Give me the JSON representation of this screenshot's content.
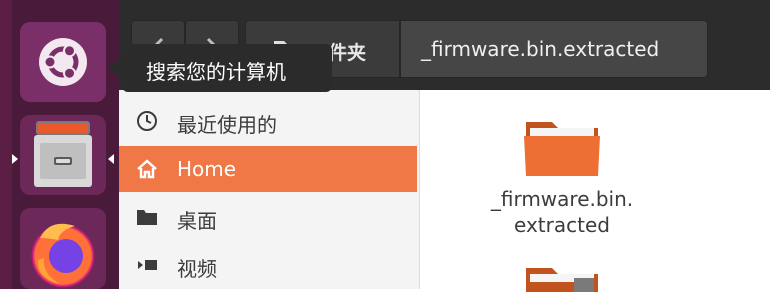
{
  "launcher": {
    "items": [
      {
        "name": "Ubuntu Dash"
      },
      {
        "name": "Files"
      },
      {
        "name": "Firefox"
      }
    ],
    "tooltip": "搜索您的计算机"
  },
  "toolbar": {
    "breadcrumb_parent": "件夹",
    "breadcrumb_current": "_firmware.bin.extracted"
  },
  "sidebar": {
    "items": [
      {
        "label": "最近使用的",
        "icon": "clock-icon"
      },
      {
        "label": "Home",
        "icon": "home-icon",
        "active": true
      },
      {
        "label": "桌面",
        "icon": "folder-icon"
      },
      {
        "label": "视频",
        "icon": "video-icon"
      }
    ]
  },
  "content": {
    "items": [
      {
        "label_line1": "_firmware.bin.",
        "label_line2": "extracted"
      }
    ]
  },
  "colors": {
    "launcher_bg": "#4a1a3a",
    "accent": "#f07746",
    "toolbar_bg": "#2c2c2c"
  }
}
